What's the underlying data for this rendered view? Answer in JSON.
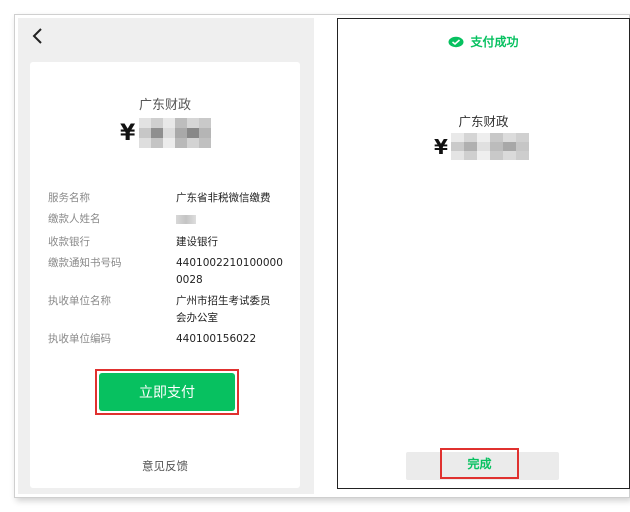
{
  "left_screen": {
    "payee": "广东财政",
    "amount_symbol": "¥",
    "details": [
      {
        "label": "服务名称",
        "value": "广东省非税微信缴费"
      },
      {
        "label": "缴款人姓名",
        "value": ""
      },
      {
        "label": "收款银行",
        "value": "建设银行"
      },
      {
        "label": "缴款通知书号码",
        "value": "4401002210100000\n0028"
      },
      {
        "label": "执收单位名称",
        "value": "广州市招生考试委员\n会办公室"
      },
      {
        "label": "执收单位编码",
        "value": "440100156022"
      }
    ],
    "pay_button_label": "立即支付",
    "feedback_label": "意见反馈"
  },
  "right_screen": {
    "success_text": "支付成功",
    "payee": "广东财政",
    "amount_symbol": "¥",
    "done_button_label": "完成"
  },
  "colors": {
    "wechat_green": "#07c160",
    "highlight_red": "#e0312f"
  }
}
